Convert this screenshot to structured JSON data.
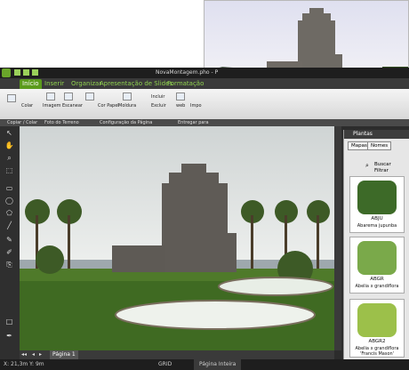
{
  "app": {
    "title": "NovaMontagem.pho - P",
    "tabs": [
      "Início",
      "Inserir",
      "Organizar",
      "Apresentação de Slides",
      "Formatação"
    ]
  },
  "ribbon": {
    "buttons": [
      "Colar",
      "Imagem",
      "Escanear",
      "Cor Papel",
      "Moldura",
      "Incluir",
      "Excluir",
      "web",
      "Impo"
    ],
    "groups": [
      "Copiar / Colar",
      "Foto do Terreno",
      "Configuração da Página",
      "Entregar para"
    ]
  },
  "plants_panel": {
    "title": "Plantas",
    "tabs": [
      "Mapas",
      "Nomes"
    ],
    "search_label": "Buscar",
    "filter_label": "Filtrar",
    "items": [
      {
        "code": "ABJU",
        "name": "Abarema jupunba"
      },
      {
        "code": "ABGR",
        "name": "Abelia x grandiflora"
      },
      {
        "code": "ABGR2",
        "name": "Abelia x grandiflora 'Francis Mason'"
      }
    ]
  },
  "pagebar": {
    "page_label": "Página 1"
  },
  "status": {
    "coords": "X: 21,3m  Y: 9m",
    "grid": "GRID",
    "zoom": "Página Inteira"
  },
  "colors": {
    "accent": "#5b9b1c",
    "chrome": "#2c2c2c",
    "sky": "#dde2e2",
    "grass": "#3f6a22"
  }
}
